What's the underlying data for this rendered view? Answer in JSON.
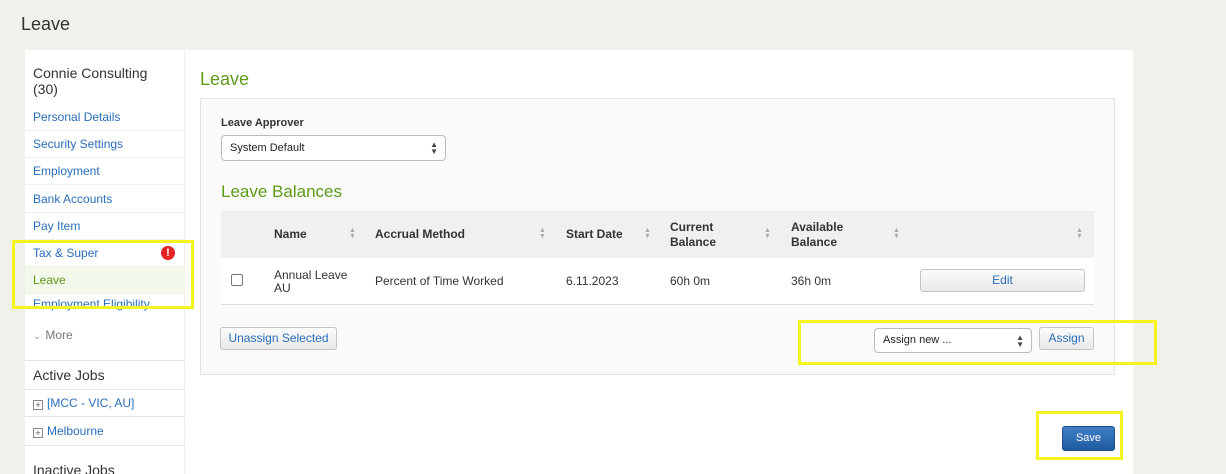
{
  "page": {
    "title": "Leave"
  },
  "sidebar": {
    "employee_name": "Connie Consulting (30)",
    "items": [
      {
        "label": "Personal Details"
      },
      {
        "label": "Security Settings"
      },
      {
        "label": "Employment"
      },
      {
        "label": "Bank Accounts"
      },
      {
        "label": "Pay Item"
      },
      {
        "label": "Tax & Super",
        "warning": "!"
      },
      {
        "label": "Leave",
        "active": true
      },
      {
        "label": "Employment Eligibility"
      }
    ],
    "more_label": "More",
    "active_jobs_title": "Active Jobs",
    "active_jobs": [
      {
        "label": "[MCC - VIC, AU]"
      },
      {
        "label": "Melbourne"
      }
    ],
    "inactive_jobs_title": "Inactive Jobs"
  },
  "main": {
    "title": "Leave",
    "leave_approver": {
      "label": "Leave Approver",
      "value": "System Default"
    },
    "balances_title": "Leave Balances",
    "table": {
      "headers": [
        "Name",
        "Accrual Method",
        "Start Date",
        "Current Balance",
        "Available Balance"
      ],
      "rows": [
        {
          "name": "Annual Leave AU",
          "accrual_method": "Percent of Time Worked",
          "start_date": "6.11.2023",
          "current_balance": "60h 0m",
          "available_balance": "36h 0m",
          "action": "Edit"
        }
      ]
    },
    "unassign_label": "Unassign Selected",
    "assign_select_value": "Assign new ...",
    "assign_label": "Assign",
    "save_label": "Save"
  },
  "colors": {
    "accent_green": "#5e9a1a",
    "link_blue": "#2a6ebb",
    "highlight_yellow": "#f4f41e",
    "save_blue": "#2d68b0",
    "warning_red": "#e32222"
  }
}
